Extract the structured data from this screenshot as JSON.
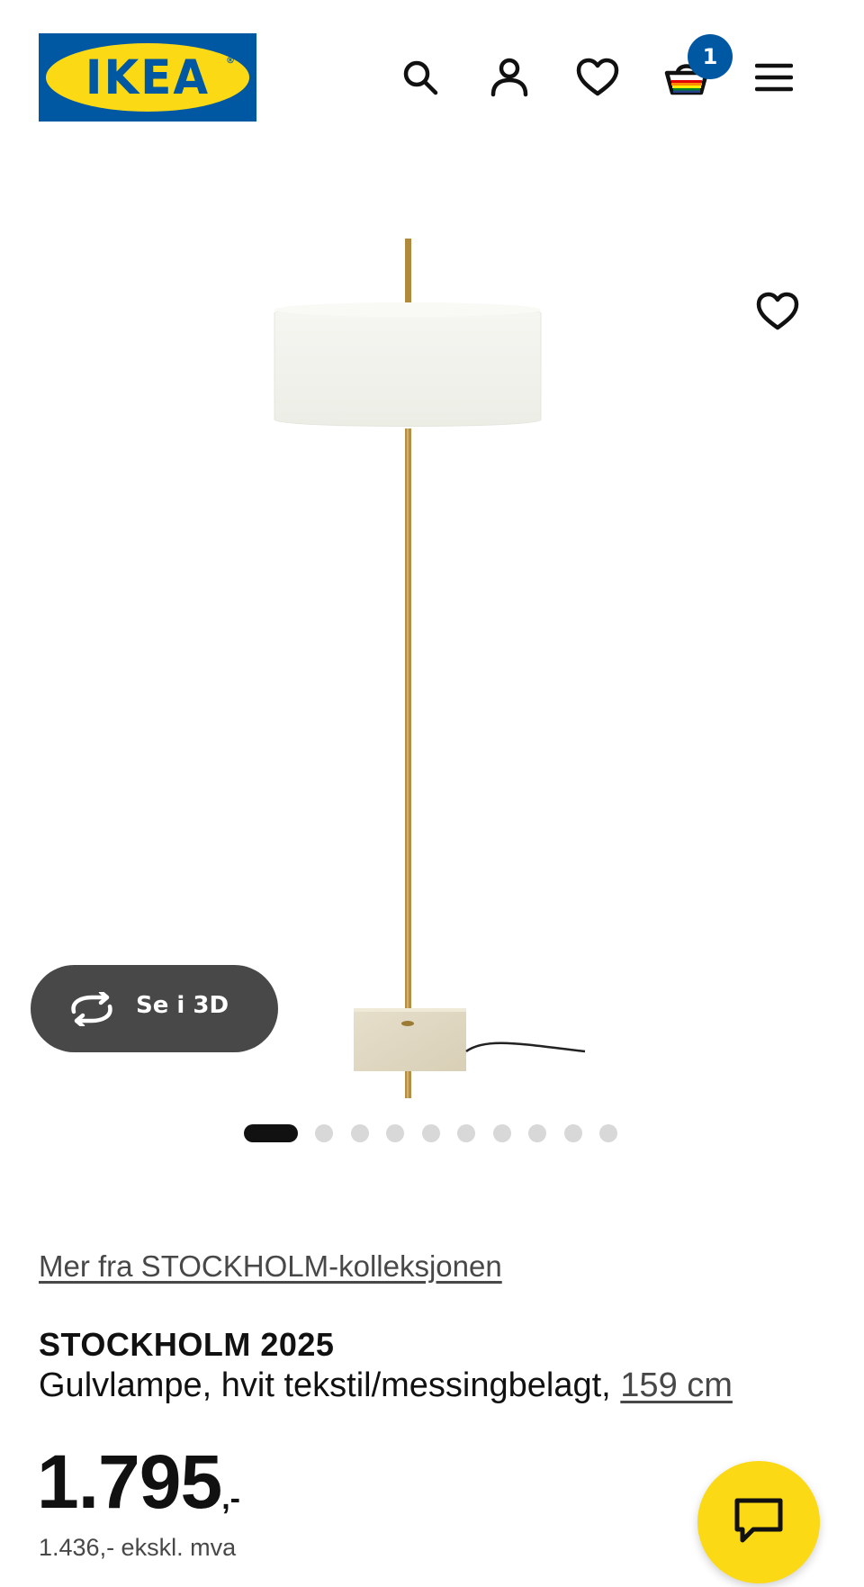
{
  "header": {
    "logo_text": "IKEA",
    "logo_reg": "®",
    "icons": [
      "search-icon",
      "account-icon",
      "favorites-icon",
      "cart-icon",
      "menu-icon"
    ],
    "cart_count": "1"
  },
  "gallery": {
    "see_3d_label": "Se i 3D",
    "image_count": 10,
    "active_index": 0
  },
  "product": {
    "collection_link": "Mer fra STOCKHOLM-kolleksjonen",
    "name": "STOCKHOLM 2025",
    "description": "Gulvlampe, hvit tekstil/messingbelagt,",
    "size": "159 cm",
    "price_integer": "1.795",
    "price_suffix": ",-",
    "price_ex_vat": "1.436,- ekskl. mva"
  },
  "colors": {
    "ikea_blue": "#0058a3",
    "ikea_yellow": "#fbd914",
    "pill_dark": "#484848"
  }
}
